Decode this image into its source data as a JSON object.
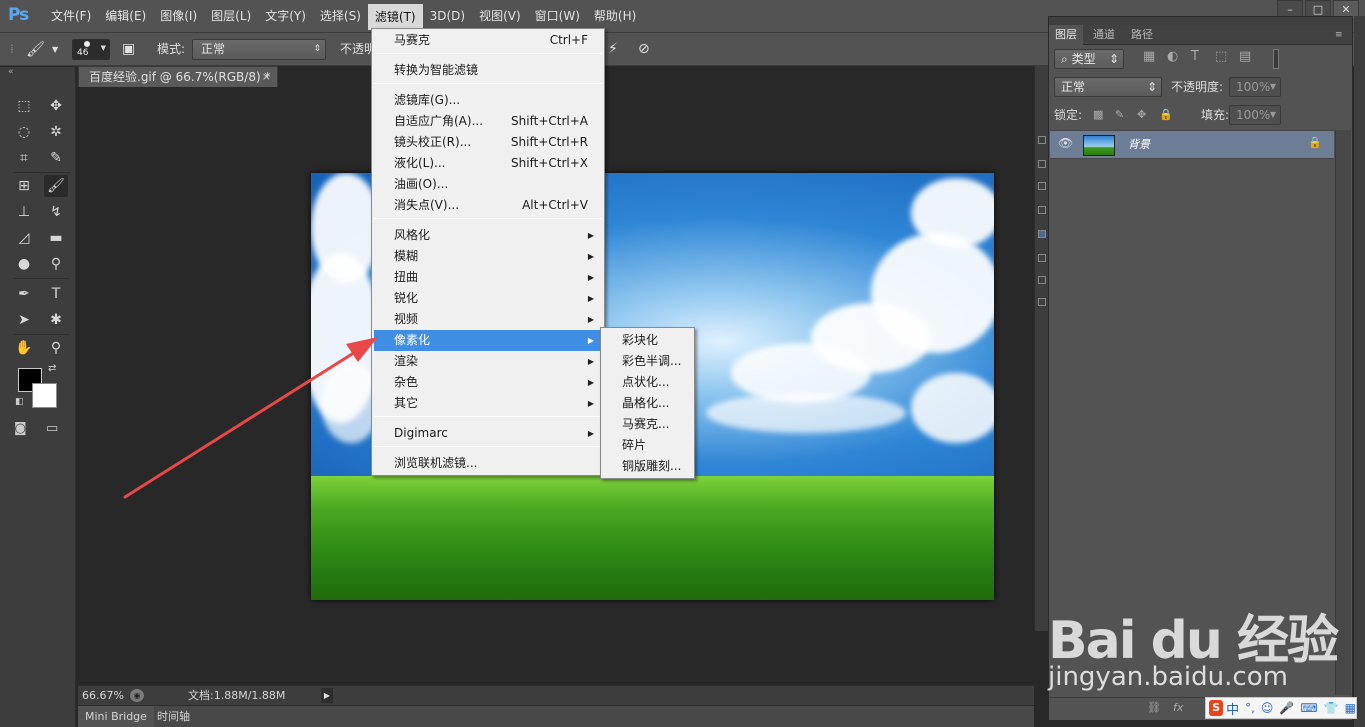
{
  "app": {
    "logo": "Ps"
  },
  "menubar": {
    "items": [
      "文件(F)",
      "编辑(E)",
      "图像(I)",
      "图层(L)",
      "文字(Y)",
      "选择(S)",
      "滤镜(T)",
      "3D(D)",
      "视图(V)",
      "窗口(W)",
      "帮助(H)"
    ],
    "active_index": 6
  },
  "window_controls": {
    "minimize": "–",
    "restore": "□",
    "close": "✕"
  },
  "options_bar": {
    "brush_size": "46",
    "mode_label": "模式:",
    "mode_value": "正常",
    "opacity_label": "不透明"
  },
  "document": {
    "tab_title": "百度经验.gif @ 66.7%(RGB/8) *",
    "tab_close": "×"
  },
  "status_bar": {
    "zoom": "66.67%",
    "doc_info": "文档:1.88M/1.88M"
  },
  "bottom_tabs": [
    "Mini Bridge",
    "时间轴"
  ],
  "filter_menu": {
    "items": [
      {
        "label": "马赛克",
        "shortcut": "Ctrl+F"
      },
      {
        "label": "转换为智能滤镜",
        "shortcut": ""
      },
      {
        "label": "滤镜库(G)...",
        "shortcut": ""
      },
      {
        "label": "自适应广角(A)...",
        "shortcut": "Shift+Ctrl+A"
      },
      {
        "label": "镜头校正(R)...",
        "shortcut": "Shift+Ctrl+R"
      },
      {
        "label": "液化(L)...",
        "shortcut": "Shift+Ctrl+X"
      },
      {
        "label": "油画(O)...",
        "shortcut": ""
      },
      {
        "label": "消失点(V)...",
        "shortcut": "Alt+Ctrl+V"
      },
      {
        "label": "风格化",
        "shortcut": ""
      },
      {
        "label": "模糊",
        "shortcut": ""
      },
      {
        "label": "扭曲",
        "shortcut": ""
      },
      {
        "label": "锐化",
        "shortcut": ""
      },
      {
        "label": "视频",
        "shortcut": ""
      },
      {
        "label": "像素化",
        "shortcut": ""
      },
      {
        "label": "渲染",
        "shortcut": ""
      },
      {
        "label": "杂色",
        "shortcut": ""
      },
      {
        "label": "其它",
        "shortcut": ""
      },
      {
        "label": "Digimarc",
        "shortcut": ""
      },
      {
        "label": "浏览联机滤镜...",
        "shortcut": ""
      }
    ],
    "highlighted": "像素化"
  },
  "pixelate_submenu": {
    "items": [
      "彩块化",
      "彩色半调...",
      "点状化...",
      "晶格化...",
      "马赛克...",
      "碎片",
      "铜版雕刻..."
    ]
  },
  "layers_panel": {
    "tabs": [
      "图层",
      "通道",
      "路径"
    ],
    "active_tab": "图层",
    "filter_kind": "类型",
    "blend_mode": "正常",
    "opacity_label": "不透明度:",
    "opacity_value": "100%",
    "lock_label": "锁定:",
    "fill_label": "填充:",
    "fill_value": "100%",
    "layer_name": "背景"
  },
  "watermark": {
    "logo_text": "Bai du 经验",
    "url": "jingyan.baidu.com"
  },
  "ime": {
    "logo": "S",
    "mode": "中"
  },
  "colors": {
    "accent_highlight": "#3e8ee6",
    "annotation_arrow": "#e84848",
    "ps_blue": "#5aa8f0"
  },
  "icons": {
    "tools": [
      "marquee-icon",
      "move-icon",
      "lasso-icon",
      "magic-wand-icon",
      "crop-icon",
      "eyedropper-icon",
      "healing-icon",
      "brush-icon",
      "stamp-icon",
      "history-brush-icon",
      "eraser-icon",
      "gradient-icon",
      "blur-icon",
      "dodge-icon",
      "pen-icon",
      "type-icon",
      "path-select-icon",
      "shape-icon",
      "hand-icon",
      "zoom-icon"
    ]
  }
}
